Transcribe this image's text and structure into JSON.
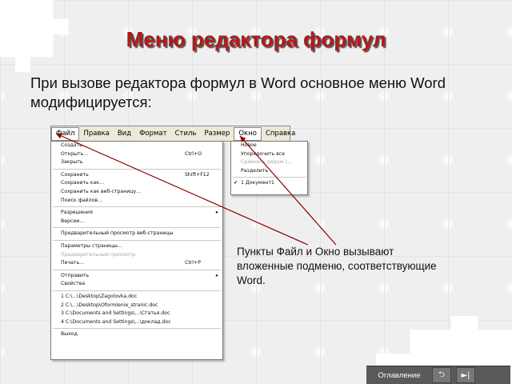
{
  "slide": {
    "title": "Меню редактора формул",
    "intro": "При вызове редактора формул в Word основное меню Word модифицируется:",
    "note": "Пункты Файл и Окно вызывают вложенные подменю, соответствующие Word."
  },
  "menubar": {
    "items": [
      "Файл",
      "Правка",
      "Вид",
      "Формат",
      "Стиль",
      "Размер",
      "Окно",
      "Справка"
    ]
  },
  "file_menu": {
    "groups": [
      [
        {
          "label": "Создать...",
          "shortcut": ""
        },
        {
          "label": "Открыть...",
          "shortcut": "Ctrl+O"
        },
        {
          "label": "Закрыть",
          "shortcut": ""
        }
      ],
      [
        {
          "label": "Сохранить",
          "shortcut": "Shift+F12"
        },
        {
          "label": "Сохранить как...",
          "shortcut": ""
        },
        {
          "label": "Сохранить как веб-страницу...",
          "shortcut": ""
        },
        {
          "label": "Поиск файлов...",
          "shortcut": ""
        }
      ],
      [
        {
          "label": "Разрешения",
          "shortcut": "",
          "submenu": true
        },
        {
          "label": "Версии...",
          "shortcut": ""
        }
      ],
      [
        {
          "label": "Предварительный просмотр веб-страницы",
          "shortcut": ""
        }
      ],
      [
        {
          "label": "Параметры страницы...",
          "shortcut": ""
        },
        {
          "label": "Предварительный просмотр",
          "shortcut": "",
          "disabled": true
        },
        {
          "label": "Печать...",
          "shortcut": "Ctrl+P"
        }
      ],
      [
        {
          "label": "Отправить",
          "shortcut": "",
          "submenu": true
        },
        {
          "label": "Свойства",
          "shortcut": ""
        }
      ],
      [
        {
          "label": "1 C:\\...\\Desktop\\Zagolovka.doc",
          "shortcut": ""
        },
        {
          "label": "2 C:\\...\\Desktop\\Oformlenie_stranic.doc",
          "shortcut": ""
        },
        {
          "label": "3 C:\\Documents and Settings\\...\\Статья.doc",
          "shortcut": ""
        },
        {
          "label": "4 C:\\Documents and Settings\\...\\доклад.doc",
          "shortcut": ""
        }
      ],
      [
        {
          "label": "Выход",
          "shortcut": ""
        }
      ]
    ]
  },
  "window_menu": {
    "items": [
      {
        "label": "Новое",
        "disabled": false
      },
      {
        "label": "Упорядочить все",
        "disabled": false
      },
      {
        "label": "Сравнить рядом с...",
        "disabled": true
      },
      {
        "label": "Разделить",
        "disabled": false
      }
    ],
    "documents": [
      {
        "label": "1 Документ1",
        "checked": true
      }
    ]
  },
  "navigation": {
    "contents_label": "Оглавление",
    "back_icon": "return-icon",
    "next_icon": "next-icon",
    "next_glyph": "►|",
    "return_glyph": "⮌"
  }
}
